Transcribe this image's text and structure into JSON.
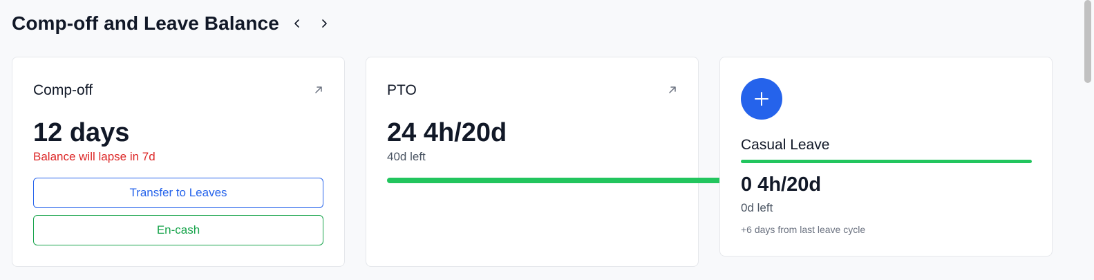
{
  "header": {
    "title": "Comp-off and Leave Balance",
    "prev_icon": "chevron-left-icon",
    "next_icon": "chevron-right-icon"
  },
  "compoff_card": {
    "label": "Comp-off",
    "value": "12 days",
    "lapse_text": "Balance will lapse in 7d",
    "transfer_label": "Transfer to Leaves",
    "encash_label": "En-cash",
    "expand_icon": "arrow-up-right-icon"
  },
  "pto_card": {
    "label": "PTO",
    "value": "24 4h/20d",
    "left_text": "40d left",
    "progress": 1.0,
    "expand_icon": "arrow-up-right-icon"
  },
  "casual_card": {
    "add_icon": "plus-icon",
    "label": "Casual Leave",
    "progress": 1.0,
    "value": "0 4h/20d",
    "left_text": "0d left",
    "note": "+6 days from last leave cycle"
  },
  "colors": {
    "primary": "#2563eb",
    "success": "#22c55e",
    "danger": "#dc2626",
    "encash": "#16a34a"
  }
}
